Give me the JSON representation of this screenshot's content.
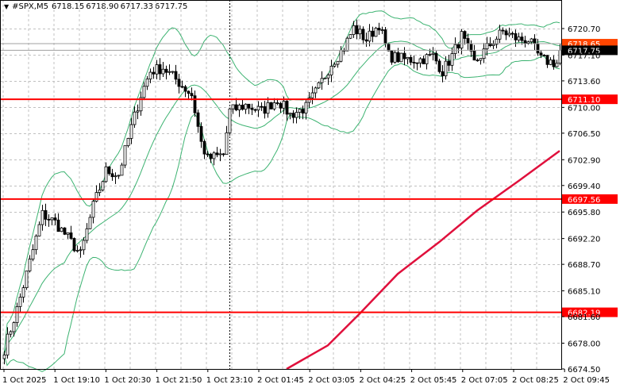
{
  "header": {
    "symbol": "#SPX,M5",
    "open": "6718.15",
    "high": "6718.90",
    "low": "6717.33",
    "close": "6717.75",
    "menu_icon": "triangle-down-icon"
  },
  "colors": {
    "background": "#ffffff",
    "grid": "#c0c0c0",
    "bands": "#3cb371",
    "ma": "#e0103c",
    "levels": "#ff0000",
    "ask_label": "#ff4500",
    "bid_label": "#000000"
  },
  "chart_data": {
    "type": "candlestick",
    "title": "#SPX,M5",
    "ylim": [
      6674.5,
      6720.7
    ],
    "y_ticks": [
      "6720.70",
      "6717.10",
      "6713.60",
      "6710.00",
      "6706.50",
      "6702.90",
      "6699.40",
      "6695.80",
      "6692.20",
      "6688.70",
      "6685.10",
      "6681.60",
      "6678.00",
      "6674.50"
    ],
    "x_ticks": [
      "1 Oct 2025",
      "1 Oct 19:10",
      "1 Oct 20:30",
      "1 Oct 21:50",
      "1 Oct 23:10",
      "2 Oct 01:45",
      "2 Oct 03:05",
      "2 Oct 04:25",
      "2 Oct 05:45",
      "2 Oct 07:05",
      "2 Oct 08:25",
      "2 Oct 09:45"
    ],
    "candle_count": 176,
    "close_keypoints": [
      [
        0,
        6677.2
      ],
      [
        4,
        6682.6
      ],
      [
        8,
        6689
      ],
      [
        12,
        6695.5
      ],
      [
        16,
        6694.4
      ],
      [
        20,
        6692.3
      ],
      [
        24,
        6690
      ],
      [
        28,
        6696.6
      ],
      [
        32,
        6701.4
      ],
      [
        36,
        6700.9
      ],
      [
        40,
        6707.3
      ],
      [
        43,
        6711.7
      ],
      [
        46,
        6714.9
      ],
      [
        50,
        6715.4
      ],
      [
        54,
        6713.8
      ],
      [
        59,
        6711.7
      ],
      [
        62,
        6705.2
      ],
      [
        64,
        6703
      ],
      [
        69,
        6703.6
      ],
      [
        71,
        6709.5
      ],
      [
        76,
        6710.3
      ],
      [
        81,
        6709.5
      ],
      [
        86,
        6711.1
      ],
      [
        90,
        6709
      ],
      [
        95,
        6710
      ],
      [
        99,
        6712.7
      ],
      [
        103,
        6716
      ],
      [
        107,
        6718.1
      ],
      [
        110,
        6720.8
      ],
      [
        114,
        6719.2
      ],
      [
        118,
        6721.3
      ],
      [
        121,
        6717
      ],
      [
        126,
        6716.5
      ],
      [
        131,
        6716.5
      ],
      [
        135,
        6717
      ],
      [
        138,
        6714.9
      ],
      [
        141,
        6717
      ],
      [
        144,
        6719.7
      ],
      [
        148,
        6716
      ],
      [
        152,
        6718.1
      ],
      [
        157,
        6720.3
      ],
      [
        162,
        6719.2
      ],
      [
        165,
        6719.2
      ],
      [
        169,
        6716.5
      ],
      [
        174,
        6716
      ],
      [
        175,
        6717.75
      ]
    ],
    "moving_average": [
      [
        89,
        6674.5
      ],
      [
        102,
        6677.7
      ],
      [
        112,
        6682
      ],
      [
        124,
        6687.4
      ],
      [
        137,
        6691.7
      ],
      [
        149,
        6696
      ],
      [
        162,
        6700
      ],
      [
        175,
        6704.1
      ]
    ],
    "bollinger": {
      "period": 20,
      "deviations": 2
    },
    "horizontal_levels": [
      {
        "label": "6711.10",
        "value": 6711.1
      },
      {
        "label": "6697.56",
        "value": 6697.56
      },
      {
        "label": "6682.19",
        "value": 6682.19
      }
    ],
    "ask": {
      "label": "6718.65",
      "value": 6718.65
    },
    "bid": {
      "label": "6717.75",
      "value": 6717.75
    },
    "period_separator_index": 71
  }
}
